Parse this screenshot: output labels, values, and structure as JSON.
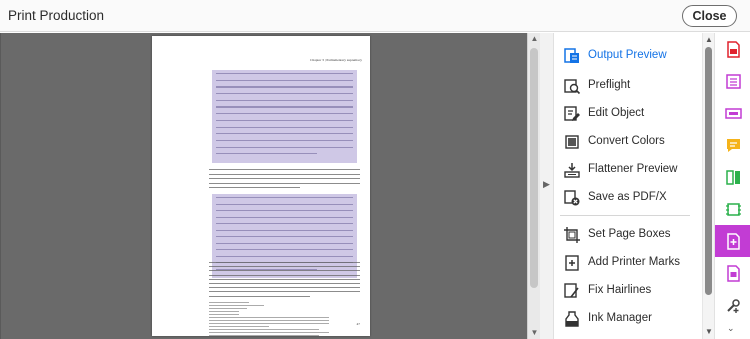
{
  "window": {
    "title": "Print Production",
    "close_label": "Close"
  },
  "document": {
    "running_head": "Chapter 3 | Parliamentary supremacy",
    "page_number": "47"
  },
  "tools_panel": {
    "items": [
      {
        "label": "Output Preview",
        "icon": "output-preview-icon",
        "active": true
      },
      {
        "label": "Preflight",
        "icon": "preflight-icon",
        "active": false
      },
      {
        "label": "Edit Object",
        "icon": "edit-object-icon",
        "active": false
      },
      {
        "label": "Convert Colors",
        "icon": "convert-colors-icon",
        "active": false
      },
      {
        "label": "Flattener Preview",
        "icon": "flattener-preview-icon",
        "active": false
      },
      {
        "label": "Save as PDF/X",
        "icon": "save-pdfx-icon",
        "active": false
      },
      {
        "label": "Set Page Boxes",
        "icon": "set-page-boxes-icon",
        "active": false
      },
      {
        "label": "Add Printer Marks",
        "icon": "add-printer-marks-icon",
        "active": false
      },
      {
        "label": "Fix Hairlines",
        "icon": "fix-hairlines-icon",
        "active": false
      },
      {
        "label": "Ink Manager",
        "icon": "ink-manager-icon",
        "active": false
      }
    ]
  },
  "right_rail": {
    "items": [
      {
        "icon": "export-pdf-icon",
        "color": "#e0222d"
      },
      {
        "icon": "organize-pages-icon",
        "color": "#c23cd4"
      },
      {
        "icon": "redact-icon",
        "color": "#c23cd4"
      },
      {
        "icon": "comment-icon",
        "color": "#f5b31a"
      },
      {
        "icon": "compare-icon",
        "color": "#2bb14b"
      },
      {
        "icon": "optimize-icon",
        "color": "#2bb14b"
      },
      {
        "icon": "print-production-icon",
        "color": "#ffffff",
        "active": true
      },
      {
        "icon": "protect-icon",
        "color": "#c23cd4"
      },
      {
        "icon": "more-tools-icon",
        "color": "#444444"
      }
    ]
  },
  "colors": {
    "accent": "#1473e6",
    "active_tool_bg": "#c23cd4",
    "highlight": "#cfc8e6"
  }
}
